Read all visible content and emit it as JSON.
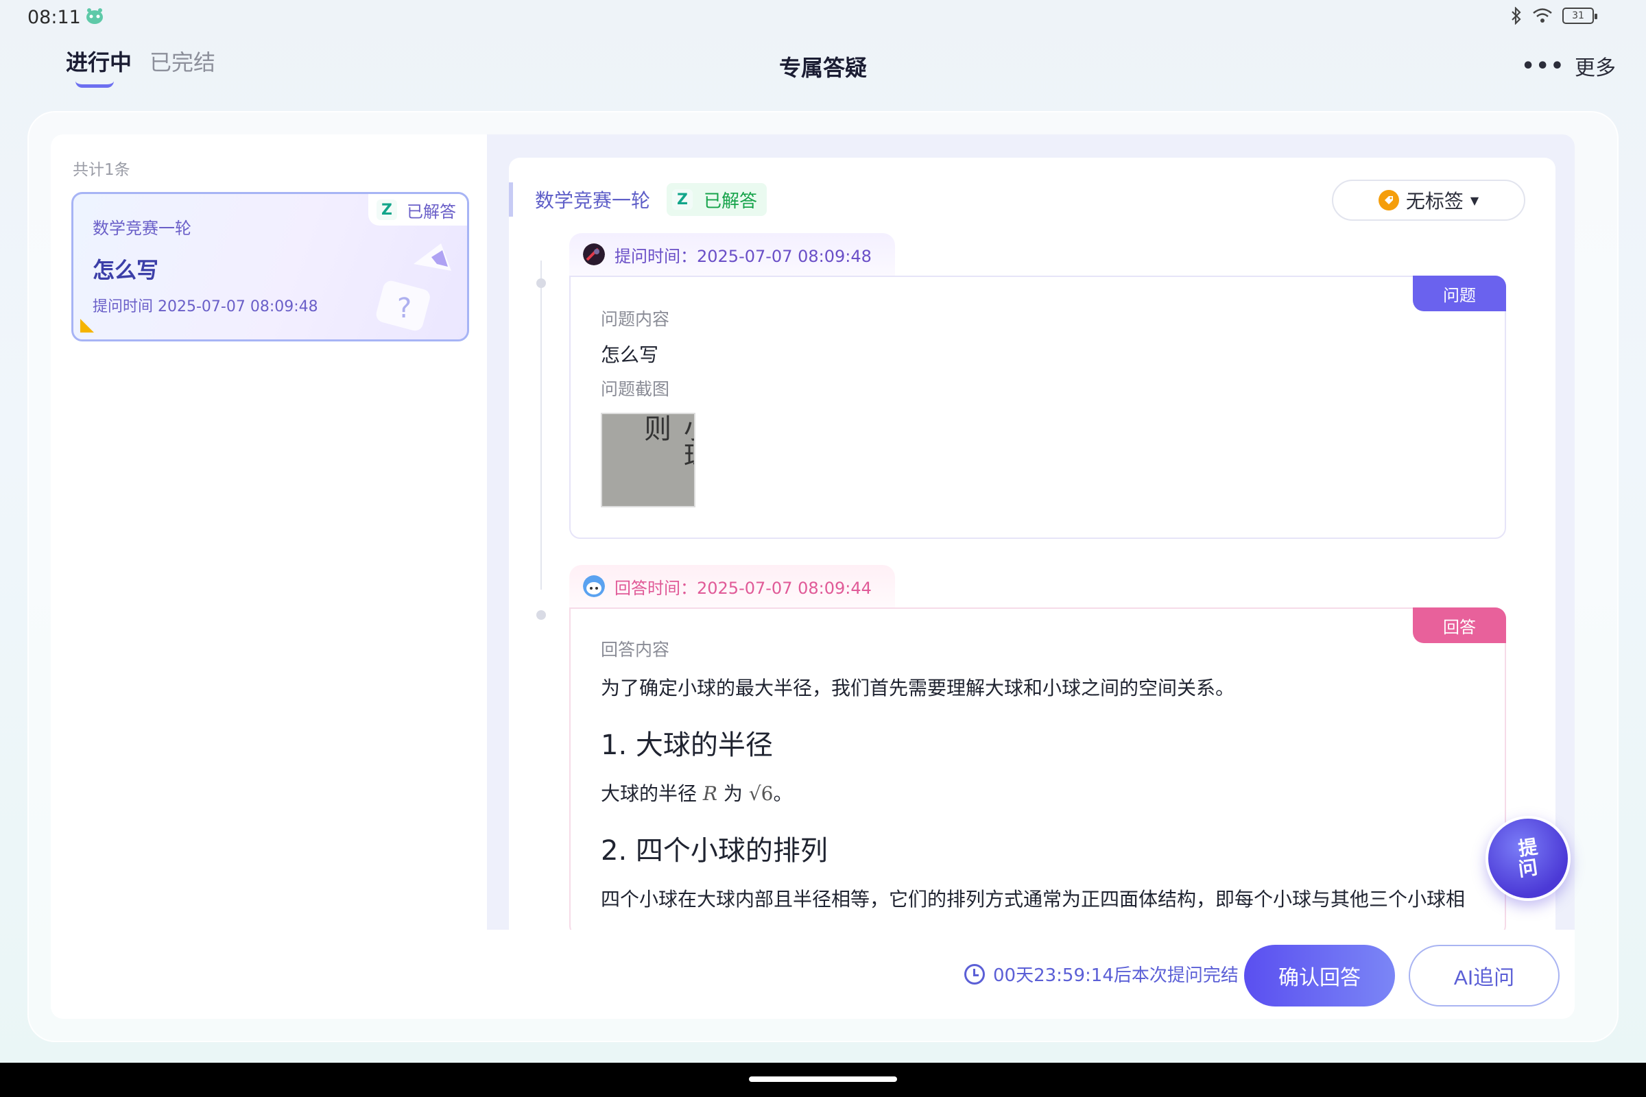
{
  "status_bar": {
    "time": "08:11",
    "battery": "31"
  },
  "header": {
    "tabs": [
      {
        "label": "进行中",
        "active": true
      },
      {
        "label": "已完结",
        "active": false
      }
    ],
    "title": "专属答疑",
    "more_label": "更多"
  },
  "list": {
    "count_label": "共计1条",
    "items": [
      {
        "subject": "数学竞赛一轮",
        "title": "怎么写",
        "status": "已解答",
        "ask_time": "提问时间 2025-07-07 08:09:48"
      }
    ]
  },
  "detail": {
    "subject": "数学竞赛一轮",
    "status": "已解答",
    "tag_label": "无标签",
    "question": {
      "time_label": "提问时间：2025-07-07 08:09:48",
      "ribbon": "问题",
      "content_label": "问题内容",
      "content": "怎么写",
      "screenshot_label": "问题截图",
      "screenshot_text": "小球，则"
    },
    "answer": {
      "time_label": "回答时间：2025-07-07 08:09:44",
      "ribbon": "回答",
      "content_label": "回答内容",
      "intro": "为了确定小球的最大半径，我们首先需要理解大球和小球之间的空间关系。",
      "h1": "1. 大球的半径",
      "p1_pre": "大球的半径 ",
      "p1_var": "R",
      "p1_mid": " 为 ",
      "p1_math": "√6",
      "p1_post": "。",
      "h2": "2. 四个小球的排列",
      "p2": "四个小球在大球内部且半径相等，它们的排列方式通常为正四面体结构，即每个小球与其他三个小球相"
    }
  },
  "float_button": {
    "line1": "提",
    "line2": "问"
  },
  "footer": {
    "countdown": "00天23:59:14后本次提问完结",
    "confirm_label": "确认回答",
    "ai_label": "AI追问"
  },
  "colors": {
    "accent": "#5b5fd6",
    "question": "#6a62ee",
    "answer": "#e8619b",
    "success": "#16a34a"
  }
}
